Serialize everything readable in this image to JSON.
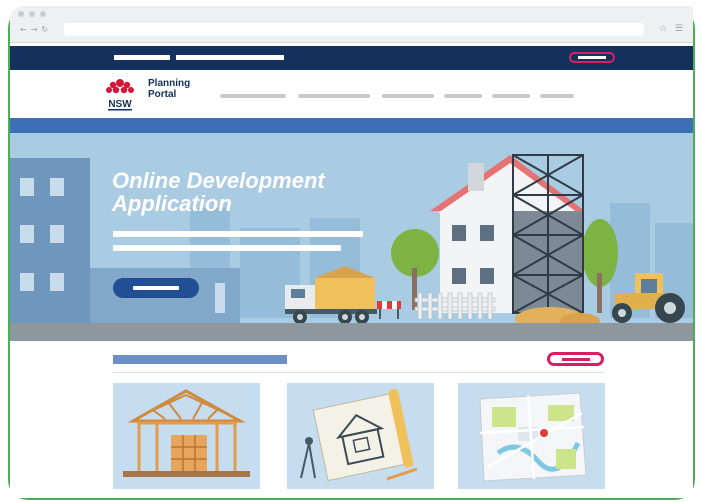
{
  "brand": {
    "logo_text": "NSW",
    "name_line1": "Planning",
    "name_line2": "Portal"
  },
  "hero": {
    "title_line1": "Online Development",
    "title_line2": "Application"
  },
  "colors": {
    "frame_green": "#4dae5a",
    "navy": "#14305c",
    "accent_blue": "#3d6fb6",
    "hero_sky": "#a9cce3",
    "pink_accent": "#d91e63",
    "card_bg": "#c6dcef"
  },
  "icons": {
    "waratah": "waratah-logo-icon",
    "house_frame": "house-frame-icon",
    "blueprint": "blueprint-icon",
    "map": "map-icon"
  }
}
